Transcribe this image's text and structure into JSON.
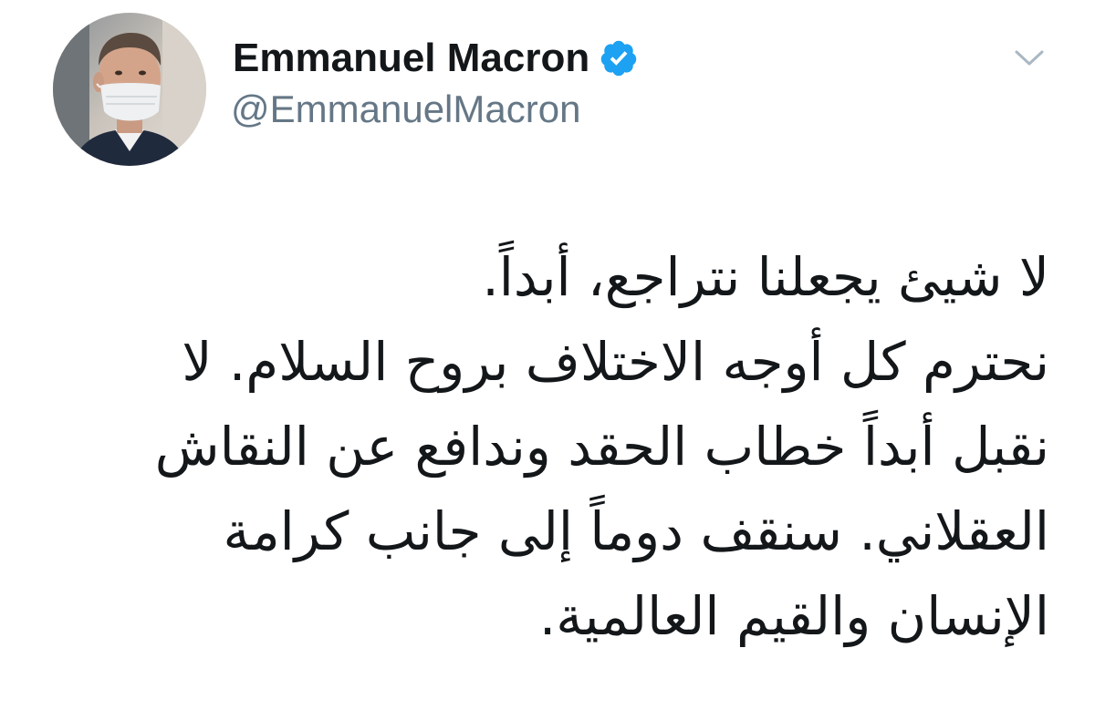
{
  "author": {
    "display_name": "Emmanuel Macron",
    "handle": "@EmmanuelMacron",
    "verified": true,
    "avatar_icon": "profile-photo-masked-man"
  },
  "menu": {
    "icon": "chevron-down-icon"
  },
  "tweet": {
    "direction": "rtl",
    "lines": [
      "لا شيئ يجعلنا نتراجع، أبداً.",
      "نحترم كل أوجه الاختلاف بروح السلام. لا",
      "نقبل أبداً خطاب الحقد وندافع عن النقاش",
      "العقلاني. سنقف دوماً إلى جانب كرامة",
      "الإنسان والقيم العالمية."
    ]
  },
  "colors": {
    "text": "#14171a",
    "secondary_text": "#657786",
    "verified_badge": "#1da1f2",
    "chevron": "#aab8c2",
    "background": "#ffffff"
  }
}
